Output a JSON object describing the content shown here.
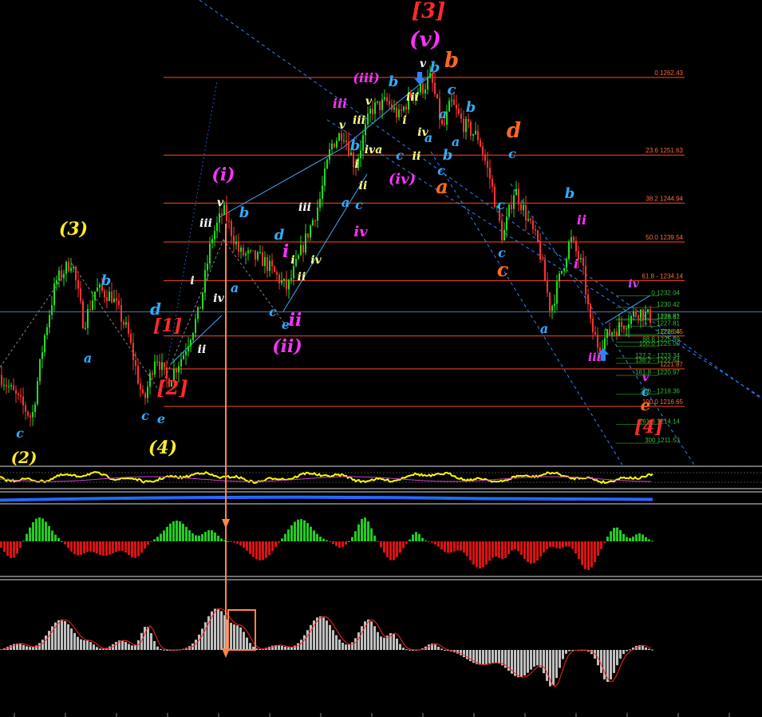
{
  "colors": {
    "background": "#000000",
    "bull": "#22dd22",
    "bear": "#ff3333",
    "fib_line": "#ff4a1a",
    "fib_text": "#ff6a3a",
    "ext_text": "#33bb33",
    "channel": "#2a86ff",
    "trendline": "#3fa9ff",
    "rsi": "#ffff00",
    "macd_pos": "#22cc22",
    "macd_neg": "#dd1111",
    "osma": "#c0c0c0",
    "signal": "#ff2222",
    "arrow": "#ff8844",
    "blue_line": "#1f6fff"
  },
  "chart_data": {
    "type": "candlestick",
    "title": "",
    "xlabel": "",
    "ylabel": "",
    "ylim": [
      1207,
      1271
    ],
    "grid": false,
    "legend": "none",
    "price_path": [
      [
        0,
        1221
      ],
      [
        20,
        1218
      ],
      [
        40,
        1215
      ],
      [
        55,
        1226
      ],
      [
        70,
        1234
      ],
      [
        90,
        1237
      ],
      [
        105,
        1228
      ],
      [
        120,
        1233
      ],
      [
        140,
        1232
      ],
      [
        160,
        1227
      ],
      [
        180,
        1217
      ],
      [
        195,
        1224
      ],
      [
        210,
        1220
      ],
      [
        230,
        1224
      ],
      [
        250,
        1230
      ],
      [
        265,
        1240
      ],
      [
        280,
        1244
      ],
      [
        300,
        1238
      ],
      [
        330,
        1237
      ],
      [
        360,
        1233
      ],
      [
        380,
        1239
      ],
      [
        400,
        1245
      ],
      [
        415,
        1253
      ],
      [
        430,
        1255
      ],
      [
        445,
        1250
      ],
      [
        465,
        1258
      ],
      [
        485,
        1259
      ],
      [
        500,
        1257
      ],
      [
        515,
        1260
      ],
      [
        530,
        1261
      ],
      [
        540,
        1262.4
      ],
      [
        555,
        1255
      ],
      [
        565,
        1259
      ],
      [
        580,
        1256
      ],
      [
        600,
        1254
      ],
      [
        615,
        1248
      ],
      [
        630,
        1240
      ],
      [
        645,
        1247
      ],
      [
        660,
        1243
      ],
      [
        675,
        1239
      ],
      [
        690,
        1230
      ],
      [
        700,
        1234
      ],
      [
        715,
        1240
      ],
      [
        730,
        1236
      ],
      [
        740,
        1228
      ],
      [
        750,
        1225
      ],
      [
        765,
        1227
      ],
      [
        780,
        1228
      ],
      [
        800,
        1230
      ],
      [
        815,
        1229
      ]
    ],
    "fib_levels": [
      {
        "label": "0 1262.43",
        "price": 1262.43
      },
      {
        "label": "23.6 1251.63",
        "price": 1251.63
      },
      {
        "label": "38.2 1244.94",
        "price": 1244.94
      },
      {
        "label": "50.0 1239.54",
        "price": 1239.54
      },
      {
        "label": "61.8 - 1234.14",
        "price": 1234.14
      },
      {
        "label": "1226.45",
        "price": 1226.45
      },
      {
        "label": "1221.87",
        "price": 1221.87
      },
      {
        "label": "100.0 1216.65",
        "price": 1216.65
      }
    ],
    "fib_extensions": [
      {
        "label": "0 1232.04",
        "price": 1232.04
      },
      {
        "label": "1230.42",
        "price": 1230.42
      },
      {
        "label": "1228.81",
        "price": 1228.81
      },
      {
        "label": "1228.67",
        "price": 1228.67
      },
      {
        "label": "1227.81",
        "price": 1227.81
      },
      {
        "label": "1226.66",
        "price": 1226.66
      },
      {
        "label": "88.6 1225.59",
        "price": 1225.59
      },
      {
        "label": "100.0 1225.00",
        "price": 1225.0
      },
      {
        "label": "127.2 - 1223.34",
        "price": 1223.34
      },
      {
        "label": "138.2 - 1222.64",
        "price": 1222.64
      },
      {
        "label": "161.8 - 1220.97",
        "price": 1220.97
      },
      {
        "label": "200 - 1218.36",
        "price": 1218.36
      },
      {
        "label": "261.8 1214.14",
        "price": 1214.14
      },
      {
        "label": "300 1211.53",
        "price": 1211.53
      }
    ],
    "current_price": 1229.8,
    "rsi_panel": "RSI",
    "macd_panel": "MACD histogram",
    "osma_panel": "OsMA"
  },
  "wave_labels": [
    {
      "t": "[3]",
      "x": 537,
      "y": 22,
      "c": "#ff2a2a",
      "s": 26
    },
    {
      "t": "(v)",
      "x": 533,
      "y": 58,
      "c": "#ff33ff",
      "s": 26
    },
    {
      "t": "b",
      "x": 566,
      "y": 84,
      "c": "#ff6a1a",
      "s": 26
    },
    {
      "t": "v",
      "x": 530,
      "y": 84,
      "c": "#ffffff",
      "s": 14
    },
    {
      "t": "(iii)",
      "x": 459,
      "y": 103,
      "c": "#ff33ff",
      "s": 16
    },
    {
      "t": "b",
      "x": 493,
      "y": 108,
      "c": "#33aaff",
      "s": 18
    },
    {
      "t": "b",
      "x": 545,
      "y": 90,
      "c": "#33aaff",
      "s": 18
    },
    {
      "t": "c",
      "x": 566,
      "y": 118,
      "c": "#33aaff",
      "s": 18
    },
    {
      "t": "b",
      "x": 590,
      "y": 140,
      "c": "#33aaff",
      "s": 18
    },
    {
      "t": "iii",
      "x": 426,
      "y": 135,
      "c": "#ff33ff",
      "s": 16
    },
    {
      "t": "v",
      "x": 462,
      "y": 131,
      "c": "#ffff88",
      "s": 14
    },
    {
      "t": "iii",
      "x": 517,
      "y": 126,
      "c": "#ffff88",
      "s": 14
    },
    {
      "t": "v",
      "x": 429,
      "y": 161,
      "c": "#ffff88",
      "s": 14
    },
    {
      "t": "iii",
      "x": 450,
      "y": 155,
      "c": "#ffff88",
      "s": 14
    },
    {
      "t": "i",
      "x": 507,
      "y": 155,
      "c": "#ffff88",
      "s": 14
    },
    {
      "t": "a",
      "x": 555,
      "y": 148,
      "c": "#33aaff",
      "s": 16
    },
    {
      "t": "iv",
      "x": 530,
      "y": 170,
      "c": "#ffff88",
      "s": 14
    },
    {
      "t": "a",
      "x": 537,
      "y": 178,
      "c": "#33aaff",
      "s": 16
    },
    {
      "t": "d",
      "x": 644,
      "y": 172,
      "c": "#ff6a1a",
      "s": 26
    },
    {
      "t": "b",
      "x": 445,
      "y": 188,
      "c": "#33aaff",
      "s": 18
    },
    {
      "t": "iva",
      "x": 468,
      "y": 192,
      "c": "#ffff88",
      "s": 14
    },
    {
      "t": "a",
      "x": 571,
      "y": 183,
      "c": "#33aaff",
      "s": 16
    },
    {
      "t": "c",
      "x": 642,
      "y": 198,
      "c": "#33aaff",
      "s": 16
    },
    {
      "t": "c",
      "x": 501,
      "y": 200,
      "c": "#33aaff",
      "s": 16
    },
    {
      "t": "ii",
      "x": 522,
      "y": 200,
      "c": "#ffff88",
      "s": 14
    },
    {
      "t": "b",
      "x": 561,
      "y": 200,
      "c": "#33aaff",
      "s": 18
    },
    {
      "t": "i",
      "x": 447,
      "y": 210,
      "c": "#ffff88",
      "s": 14
    },
    {
      "t": "c",
      "x": 553,
      "y": 219,
      "c": "#33aaff",
      "s": 16
    },
    {
      "t": "(i)",
      "x": 280,
      "y": 226,
      "c": "#ff33ff",
      "s": 22
    },
    {
      "t": "(iv)",
      "x": 504,
      "y": 230,
      "c": "#ff33ff",
      "s": 18
    },
    {
      "t": "a",
      "x": 554,
      "y": 242,
      "c": "#ff6a1a",
      "s": 24
    },
    {
      "t": "ii",
      "x": 455,
      "y": 237,
      "c": "#ffff88",
      "s": 14
    },
    {
      "t": "b",
      "x": 714,
      "y": 248,
      "c": "#33aaff",
      "s": 18
    },
    {
      "t": "a",
      "x": 433,
      "y": 259,
      "c": "#33aaff",
      "s": 16
    },
    {
      "t": "c",
      "x": 450,
      "y": 262,
      "c": "#33aaff",
      "s": 16
    },
    {
      "t": "c",
      "x": 628,
      "y": 262,
      "c": "#33aaff",
      "s": 16
    },
    {
      "t": "iii",
      "x": 382,
      "y": 264,
      "c": "#ffffff",
      "s": 14
    },
    {
      "t": "v",
      "x": 276,
      "y": 258,
      "c": "#ffffff",
      "s": 14
    },
    {
      "t": "b",
      "x": 306,
      "y": 272,
      "c": "#33aaff",
      "s": 18
    },
    {
      "t": "iii",
      "x": 258,
      "y": 284,
      "c": "#ffffff",
      "s": 14
    },
    {
      "t": "ii",
      "x": 729,
      "y": 281,
      "c": "#ff33ff",
      "s": 16
    },
    {
      "t": "(3)",
      "x": 92,
      "y": 294,
      "c": "#ffee22",
      "s": 22
    },
    {
      "t": "iv",
      "x": 452,
      "y": 296,
      "c": "#ff33ff",
      "s": 18
    },
    {
      "t": "d",
      "x": 350,
      "y": 300,
      "c": "#33aaff",
      "s": 18
    },
    {
      "t": "i",
      "x": 358,
      "y": 322,
      "c": "#ff33ff",
      "s": 22
    },
    {
      "t": "i",
      "x": 367,
      "y": 330,
      "c": "#ffff88",
      "s": 14
    },
    {
      "t": "iv",
      "x": 396,
      "y": 330,
      "c": "#ffff88",
      "s": 14
    },
    {
      "t": "c",
      "x": 629,
      "y": 322,
      "c": "#33aaff",
      "s": 16
    },
    {
      "t": "i",
      "x": 722,
      "y": 336,
      "c": "#ff33ff",
      "s": 16
    },
    {
      "t": "c",
      "x": 630,
      "y": 346,
      "c": "#ff6a1a",
      "s": 24
    },
    {
      "t": "ii",
      "x": 378,
      "y": 351,
      "c": "#ffff88",
      "s": 14
    },
    {
      "t": "b",
      "x": 133,
      "y": 357,
      "c": "#33aaff",
      "s": 18
    },
    {
      "t": "i",
      "x": 241,
      "y": 356,
      "c": "#ffffff",
      "s": 14
    },
    {
      "t": "a",
      "x": 294,
      "y": 366,
      "c": "#33aaff",
      "s": 16
    },
    {
      "t": "iv",
      "x": 794,
      "y": 360,
      "c": "#cc44ff",
      "s": 14
    },
    {
      "t": "iv",
      "x": 274,
      "y": 378,
      "c": "#ffffff",
      "s": 14
    },
    {
      "t": "d",
      "x": 195,
      "y": 394,
      "c": "#33aaff",
      "s": 20
    },
    {
      "t": "c",
      "x": 342,
      "y": 396,
      "c": "#33aaff",
      "s": 16
    },
    {
      "t": "ii",
      "x": 370,
      "y": 408,
      "c": "#ff33ff",
      "s": 22
    },
    {
      "t": "e",
      "x": 358,
      "y": 412,
      "c": "#33aaff",
      "s": 16
    },
    {
      "t": "[1]",
      "x": 210,
      "y": 415,
      "c": "#ff2a2a",
      "s": 22
    },
    {
      "t": "a",
      "x": 682,
      "y": 417,
      "c": "#33aaff",
      "s": 16
    },
    {
      "t": "ii",
      "x": 253,
      "y": 442,
      "c": "#ffffff",
      "s": 14
    },
    {
      "t": "(ii)",
      "x": 360,
      "y": 441,
      "c": "#ff33ff",
      "s": 22
    },
    {
      "t": "a",
      "x": 110,
      "y": 454,
      "c": "#33aaff",
      "s": 16
    },
    {
      "t": "iii",
      "x": 745,
      "y": 452,
      "c": "#ff33ff",
      "s": 14
    },
    {
      "t": "v",
      "x": 809,
      "y": 477,
      "c": "#ff33ff",
      "s": 14
    },
    {
      "t": "[2]",
      "x": 216,
      "y": 494,
      "c": "#ff2a2a",
      "s": 24
    },
    {
      "t": "c",
      "x": 809,
      "y": 496,
      "c": "#33aaff",
      "s": 16
    },
    {
      "t": "e",
      "x": 809,
      "y": 514,
      "c": "#ff6a1a",
      "s": 20
    },
    {
      "t": "c",
      "x": 182,
      "y": 526,
      "c": "#33aaff",
      "s": 16
    },
    {
      "t": "e",
      "x": 202,
      "y": 530,
      "c": "#33aaff",
      "s": 16
    },
    {
      "t": "[4]",
      "x": 813,
      "y": 542,
      "c": "#ff2a2a",
      "s": 22
    },
    {
      "t": "c",
      "x": 25,
      "y": 548,
      "c": "#33aaff",
      "s": 16
    },
    {
      "t": "(4)",
      "x": 204,
      "y": 568,
      "c": "#ffee22",
      "s": 22
    },
    {
      "t": "(2)",
      "x": 30,
      "y": 580,
      "c": "#ffee22",
      "s": 20
    }
  ]
}
